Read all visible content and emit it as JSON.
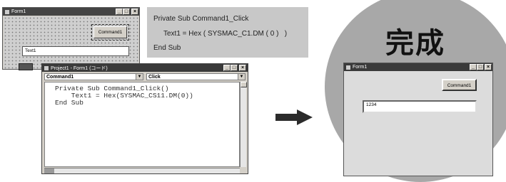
{
  "design_form": {
    "title": "Form1",
    "button_label": "Command1",
    "textbox_value": "Text1",
    "title_buttons": [
      "_",
      "□",
      "×"
    ]
  },
  "code_snippet": {
    "line1": "Private Sub Command1_Click",
    "line2": "Text1 = Hex ( SYSMAC_C1.DM ( 0 )   )",
    "line3": "End Sub"
  },
  "code_window": {
    "title": "Project1 - Form1 (コード)",
    "object_combo": "Command1",
    "procedure_combo": "Click",
    "code_line1": "Private Sub Command1_Click()",
    "code_line2": "    Text1 = Hex(SYSMAC_CS11.DM(0))",
    "code_line3": "End Sub",
    "title_buttons": [
      "_",
      "□",
      "×"
    ]
  },
  "result": {
    "heading": "完成",
    "form_title": "Form1",
    "button_label": "Command1",
    "textbox_value": "1234",
    "title_buttons": [
      "_",
      "□",
      "×"
    ]
  },
  "colors": {
    "arrow": "#2b2b2b",
    "circle": "#a8a8a8",
    "titlebar": "#3a3a3a"
  }
}
